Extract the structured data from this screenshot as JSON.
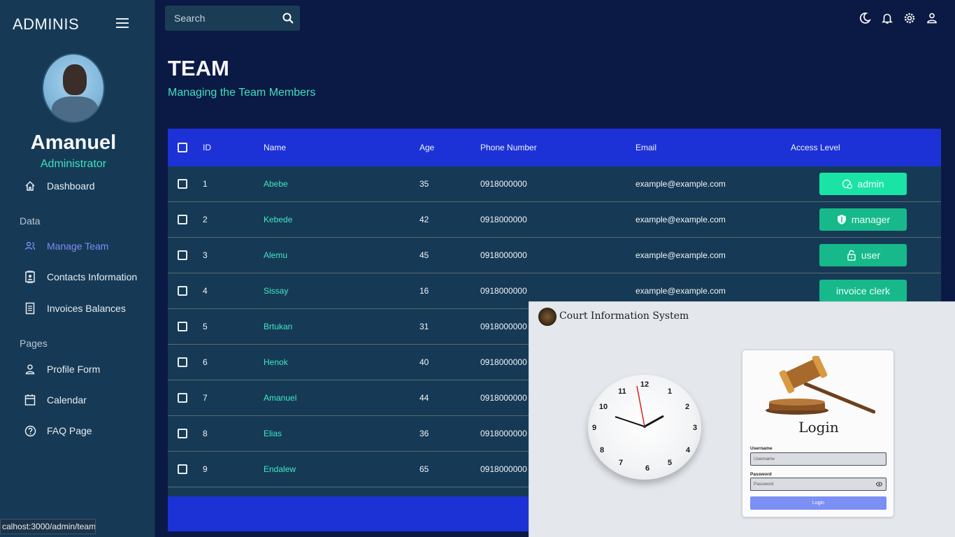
{
  "sidebar": {
    "brand": "ADMINIS",
    "user_name": "Amanuel",
    "user_role": "Administrator",
    "items": [
      {
        "label": "Dashboard",
        "icon": "home-icon",
        "active": false
      },
      {
        "label": "Manage Team",
        "icon": "people-icon",
        "active": true
      },
      {
        "label": "Contacts Information",
        "icon": "contacts-icon",
        "active": false
      },
      {
        "label": "Invoices Balances",
        "icon": "receipt-icon",
        "active": false
      },
      {
        "label": "Profile Form",
        "icon": "person-icon",
        "active": false
      },
      {
        "label": "Calendar",
        "icon": "calendar-icon",
        "active": false
      },
      {
        "label": "FAQ Page",
        "icon": "help-icon",
        "active": false
      }
    ],
    "sections": [
      "Data",
      "Pages"
    ]
  },
  "topbar": {
    "search_placeholder": "Search",
    "icons": [
      "dark-mode-icon",
      "notifications-icon",
      "settings-icon",
      "person-icon"
    ]
  },
  "header": {
    "title": "TEAM",
    "subtitle": "Managing the Team Members"
  },
  "table": {
    "columns": [
      "ID",
      "Name",
      "Age",
      "Phone Number",
      "Email",
      "Access Level"
    ],
    "rows": [
      {
        "id": "1",
        "name": "Abebe",
        "age": "35",
        "phone": "0918000000",
        "email": "example@example.com",
        "access": "admin"
      },
      {
        "id": "2",
        "name": "Kebede",
        "age": "42",
        "phone": "0918000000",
        "email": "example@example.com",
        "access": "manager"
      },
      {
        "id": "3",
        "name": "Alemu",
        "age": "45",
        "phone": "0918000000",
        "email": "example@example.com",
        "access": "user"
      },
      {
        "id": "4",
        "name": "Sissay",
        "age": "16",
        "phone": "0918000000",
        "email": "example@example.com",
        "access": "invoice clerk"
      },
      {
        "id": "5",
        "name": "Brtukan",
        "age": "31",
        "phone": "0918000000"
      },
      {
        "id": "6",
        "name": "Henok",
        "age": "40",
        "phone": "0918000000"
      },
      {
        "id": "7",
        "name": "Amanuel",
        "age": "44",
        "phone": "0918000000"
      },
      {
        "id": "8",
        "name": "Elias",
        "age": "36",
        "phone": "0918000000"
      },
      {
        "id": "9",
        "name": "Endalew",
        "age": "65",
        "phone": "0918000000"
      }
    ]
  },
  "status_url": "calhost:3000/admin/team",
  "court_window": {
    "title": "Court Information System",
    "clock_numbers": [
      "12",
      "1",
      "2",
      "3",
      "4",
      "5",
      "6",
      "7",
      "8",
      "9",
      "10",
      "11"
    ],
    "login_heading": "Login",
    "username_label": "Username",
    "username_placeholder": "Username",
    "password_label": "Password",
    "password_placeholder": "Password",
    "login_button": "Login"
  },
  "colors": {
    "background": "#0b1a44",
    "sidebar": "#163a55",
    "table_header": "#1d32d6",
    "accent_teal": "#3fe0c0",
    "active_nav": "#7f8cf6",
    "access_admin": "#1ae3a6",
    "access_other": "#17b98a"
  }
}
